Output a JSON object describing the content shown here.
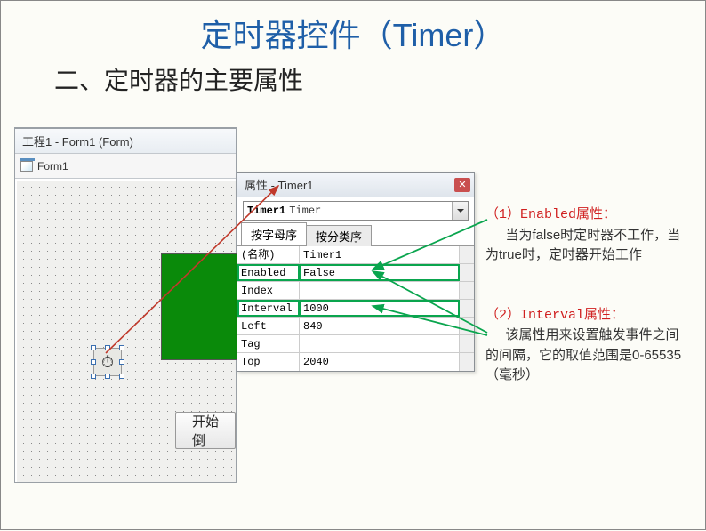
{
  "title": "定时器控件（Timer）",
  "subtitle": "二、定时器的主要属性",
  "vb": {
    "window_title": "工程1 - Form1 (Form)",
    "tree_item": "Form1",
    "button_label": "开始倒"
  },
  "props": {
    "title": "属性 - Timer1",
    "selector_bold": "Timer1",
    "selector_type": "Timer",
    "tab_alpha": "按字母序",
    "tab_category": "按分类序",
    "rows": {
      "name_k": "(名称)",
      "name_v": "Timer1",
      "enabled_k": "Enabled",
      "enabled_v": "False",
      "index_k": "Index",
      "index_v": "",
      "interval_k": "Interval",
      "interval_v": "1000",
      "left_k": "Left",
      "left_v": "840",
      "tag_k": "Tag",
      "tag_v": "",
      "top_k": "Top",
      "top_v": "2040"
    }
  },
  "anno": {
    "h1": "（1）Enabled属性：",
    "b1": "当为false时定时器不工作，当为true时，定时器开始工作",
    "h2": "（2）Interval属性：",
    "b2": "该属性用来设置触发事件之间的间隔，它的取值范围是0-65535（毫秒）"
  }
}
